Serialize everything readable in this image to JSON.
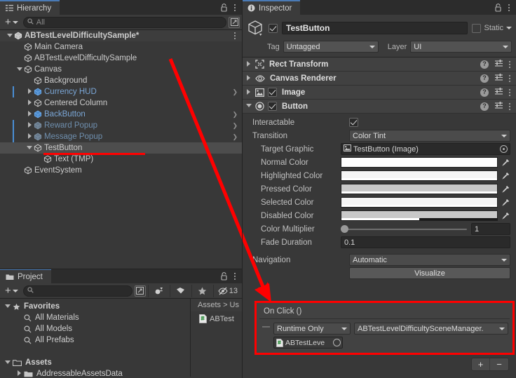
{
  "hierarchy": {
    "tab_label": "Hierarchy",
    "tab_icon": "hierarchy-icon",
    "search_placeholder": "All",
    "add_label": "+",
    "items": [
      {
        "label": "ABTestLevelDifficultySample*",
        "depth": 1,
        "foldout": "open",
        "icon": "prefab-root-icon",
        "selected": false,
        "tinted": true,
        "bold": true,
        "style": "normal",
        "chevron": false,
        "mark": false
      },
      {
        "label": "Main Camera",
        "depth": 2,
        "foldout": "none",
        "icon": "gameobject-icon",
        "selected": false,
        "tinted": false,
        "bold": false,
        "style": "normal",
        "chevron": false,
        "mark": false
      },
      {
        "label": "ABTestLevelDifficultySample",
        "depth": 2,
        "foldout": "none",
        "icon": "gameobject-icon",
        "selected": false,
        "tinted": false,
        "bold": false,
        "style": "normal",
        "chevron": false,
        "mark": false
      },
      {
        "label": "Canvas",
        "depth": 2,
        "foldout": "open",
        "icon": "gameobject-icon",
        "selected": false,
        "tinted": false,
        "bold": false,
        "style": "normal",
        "chevron": false,
        "mark": false
      },
      {
        "label": "Background",
        "depth": 3,
        "foldout": "none",
        "icon": "gameobject-icon",
        "selected": false,
        "tinted": false,
        "bold": false,
        "style": "normal",
        "chevron": false,
        "mark": false
      },
      {
        "label": "Currency HUD",
        "depth": 3,
        "foldout": "closed",
        "icon": "prefab-icon",
        "selected": false,
        "tinted": false,
        "bold": false,
        "style": "prefab",
        "chevron": true,
        "mark": true
      },
      {
        "label": "Centered Column",
        "depth": 3,
        "foldout": "closed",
        "icon": "gameobject-icon",
        "selected": false,
        "tinted": false,
        "bold": false,
        "style": "normal",
        "chevron": false,
        "mark": false
      },
      {
        "label": "BackButton",
        "depth": 3,
        "foldout": "closed",
        "icon": "prefab-icon",
        "selected": false,
        "tinted": false,
        "bold": false,
        "style": "prefab",
        "chevron": true,
        "mark": false
      },
      {
        "label": "Reward Popup",
        "depth": 3,
        "foldout": "closed",
        "icon": "prefab-dim-icon",
        "selected": false,
        "tinted": false,
        "bold": false,
        "style": "prefab-dim",
        "chevron": true,
        "mark": true
      },
      {
        "label": "Message Popup",
        "depth": 3,
        "foldout": "closed",
        "icon": "prefab-dim-icon",
        "selected": false,
        "tinted": false,
        "bold": false,
        "style": "prefab-dim",
        "chevron": true,
        "mark": true
      },
      {
        "label": "TestButton",
        "depth": 3,
        "foldout": "open",
        "icon": "gameobject-icon",
        "selected": true,
        "tinted": false,
        "bold": false,
        "style": "normal",
        "chevron": false,
        "mark": false
      },
      {
        "label": "Text (TMP)",
        "depth": 4,
        "foldout": "none",
        "icon": "gameobject-icon",
        "selected": false,
        "tinted": false,
        "bold": false,
        "style": "normal",
        "chevron": false,
        "mark": false
      },
      {
        "label": "EventSystem",
        "depth": 2,
        "foldout": "none",
        "icon": "gameobject-icon",
        "selected": false,
        "tinted": false,
        "bold": false,
        "style": "normal",
        "chevron": false,
        "mark": false
      }
    ]
  },
  "project": {
    "tab_label": "Project",
    "tab_icon": "folder-icon",
    "search_placeholder": "",
    "add_label": "+",
    "hidden_count": "13",
    "toolbar_icons": [
      "save-filter-icon",
      "label-icon",
      "favorite-star-icon",
      "hidden-packages-icon"
    ],
    "tree": [
      {
        "label": "Favorites",
        "depth": 0,
        "foldout": "open",
        "icon": "favorite-star-icon",
        "bold": true
      },
      {
        "label": "All Materials",
        "depth": 1,
        "foldout": "none",
        "icon": "search-icon",
        "bold": false
      },
      {
        "label": "All Models",
        "depth": 1,
        "foldout": "none",
        "icon": "search-icon",
        "bold": false
      },
      {
        "label": "All Prefabs",
        "depth": 1,
        "foldout": "none",
        "icon": "search-icon",
        "bold": false
      },
      {
        "label": "",
        "depth": 0,
        "foldout": "none",
        "icon": "none",
        "bold": false
      },
      {
        "label": "Assets",
        "depth": 0,
        "foldout": "open",
        "icon": "folder-open-icon",
        "bold": true
      },
      {
        "label": "AddressableAssetsData",
        "depth": 1,
        "foldout": "closed",
        "icon": "folder-icon",
        "bold": false
      }
    ],
    "breadcrumb": "Assets > Us",
    "asset_name": "ABTest",
    "asset_icon": "csharp-script-icon"
  },
  "inspector": {
    "tab_label": "Inspector",
    "tab_icon": "info-icon",
    "gameobject": {
      "enabled": true,
      "name": "TestButton",
      "static_label": "Static",
      "static_checked": false,
      "tag_label": "Tag",
      "tag_value": "Untagged",
      "layer_label": "Layer",
      "layer_value": "UI"
    },
    "components": [
      {
        "name": "Rect Transform",
        "icon": "rect-transform-icon",
        "expanded": false,
        "has_toggle": false,
        "enabled": false
      },
      {
        "name": "Canvas Renderer",
        "icon": "canvas-renderer-icon",
        "expanded": false,
        "has_toggle": false,
        "enabled": false
      },
      {
        "name": "Image",
        "icon": "image-icon",
        "expanded": false,
        "has_toggle": true,
        "enabled": true
      },
      {
        "name": "Button",
        "icon": "button-icon",
        "expanded": true,
        "has_toggle": true,
        "enabled": true
      }
    ],
    "button_component": {
      "interactable_label": "Interactable",
      "interactable_value": true,
      "transition_label": "Transition",
      "transition_value": "Color Tint",
      "target_graphic_label": "Target Graphic",
      "target_graphic_value": "TestButton (Image)",
      "target_graphic_icon": "image-icon",
      "colors": [
        {
          "label": "Normal Color",
          "hex": "#ffffff",
          "alpha": 100
        },
        {
          "label": "Highlighted Color",
          "hex": "#f5f5f5",
          "alpha": 100
        },
        {
          "label": "Pressed Color",
          "hex": "#c8c8c8",
          "alpha": 100
        },
        {
          "label": "Selected Color",
          "hex": "#f5f5f5",
          "alpha": 100
        },
        {
          "label": "Disabled Color",
          "hex": "#c8c8c8",
          "alpha": 50
        }
      ],
      "color_multiplier_label": "Color Multiplier",
      "color_multiplier_value": "1",
      "fade_duration_label": "Fade Duration",
      "fade_duration_value": "0.1",
      "navigation_label": "Navigation",
      "navigation_value": "Automatic",
      "visualize_label": "Visualize"
    },
    "on_click": {
      "title": "On Click ()",
      "entry": {
        "mode_value": "Runtime Only",
        "function_value": "ABTestLevelDifficultySceneManager.",
        "object_value": "ABTestLeve",
        "object_icon": "csharp-script-icon"
      },
      "add_label": "+",
      "remove_label": "−"
    }
  },
  "annotations": {
    "highlight_color": "#ff0000",
    "underline_target": "TestButton",
    "arrow_from": "TestButton hierarchy row",
    "arrow_to": "On Click () section"
  }
}
